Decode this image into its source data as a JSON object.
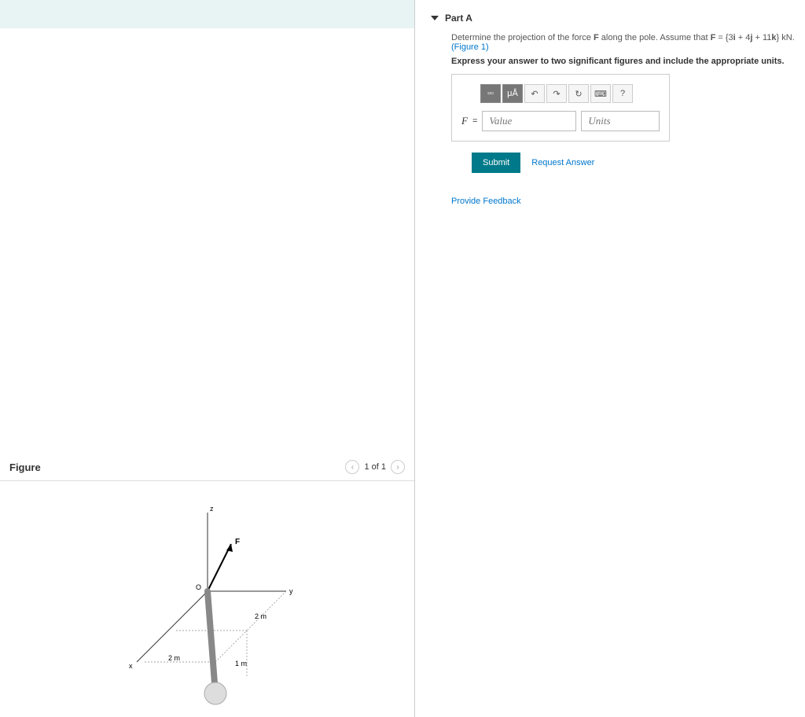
{
  "part": {
    "title": "Part A",
    "question_prefix": "Determine the projection of the force ",
    "question_mid": " along the pole. Assume that ",
    "force_symbol": "F",
    "equation": "F = {3i + 4j + 11k} kN",
    "units_text": ".",
    "figure_ref": "(Figure 1)",
    "instruction": "Express your answer to two significant figures and include the appropriate units.",
    "var_label": "F",
    "equals": "=",
    "value_placeholder": "Value",
    "units_placeholder": "Units",
    "submit": "Submit",
    "request_answer": "Request Answer"
  },
  "toolbar": {
    "templates": "▫▫",
    "micro": "μÅ",
    "undo": "↶",
    "redo": "↷",
    "reset": "↻",
    "keyboard": "⌨",
    "help": "?"
  },
  "feedback": "Provide Feedback",
  "figure": {
    "title": "Figure",
    "pager": "1 of 1",
    "labels": {
      "z": "z",
      "y": "y",
      "x": "x",
      "F": "F",
      "O": "O",
      "d1": "2 m",
      "d2": "2 m",
      "d3": "1 m"
    }
  }
}
